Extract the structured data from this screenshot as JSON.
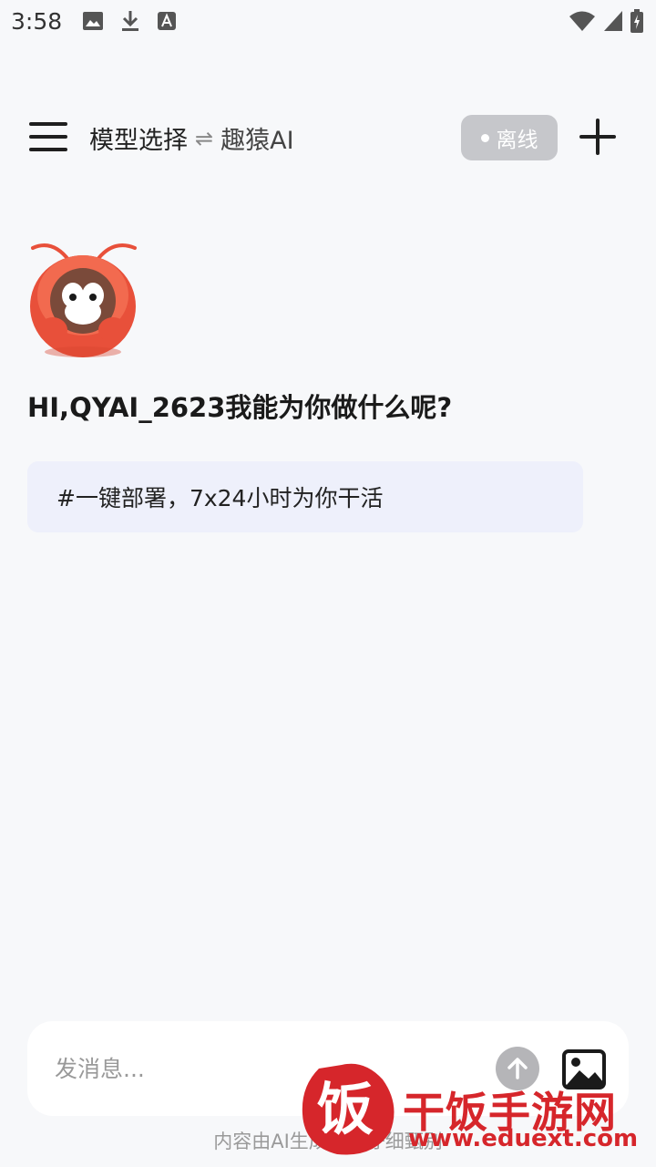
{
  "status_bar": {
    "time": "3:58",
    "left_icons": [
      "image-icon",
      "download-icon",
      "text-a-icon"
    ],
    "right_icons": [
      "wifi-icon",
      "signal-icon",
      "battery-icon"
    ]
  },
  "header": {
    "menu_icon": "hamburger-menu-icon",
    "title": "模型选择",
    "swap_symbol": "⇌",
    "model_name": "趣猿AI",
    "status_badge": "离线",
    "add_icon": "plus-icon"
  },
  "main": {
    "greeting": "HI,QYAI_2623我能为你做什么呢?",
    "suggestion": "#一键部署，7x24小时为你干活"
  },
  "input": {
    "placeholder": "发消息...",
    "value": "",
    "send_icon": "arrow-up-icon",
    "image_icon": "image-upload-icon"
  },
  "footer": {
    "disclaimer": "内容由AI生成，请仔细甄别"
  },
  "watermark": {
    "logo_char": "饭",
    "site_name": "干饭手游网",
    "url": "www.eduext.com"
  },
  "colors": {
    "background": "#f7f8fa",
    "badge": "#c6c7cb",
    "suggestion_bg": "#eef0fb",
    "mascot_shell": "#e8503a",
    "watermark_red": "#d6262b"
  }
}
